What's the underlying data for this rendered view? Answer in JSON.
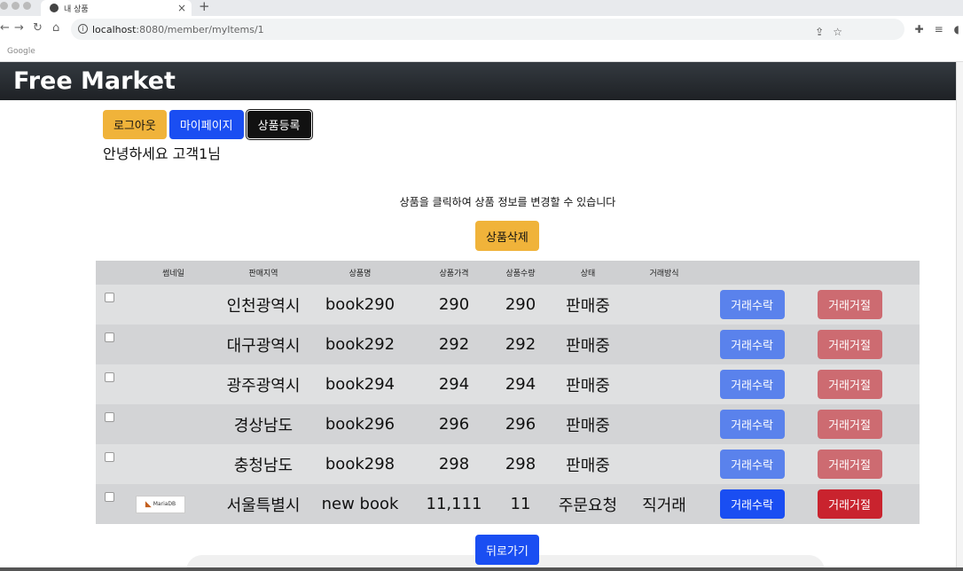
{
  "browser": {
    "tab_title": "내 상품",
    "url_host": "localhost",
    "url_path": ":8080/member/myItems/1",
    "bookmark": "Google"
  },
  "site": {
    "brand": "Free Market",
    "logout": "로그아웃",
    "mypage": "마이페이지",
    "register": "상품등록",
    "greeting": "안녕하세요 고객1님",
    "hint": "상품을 클릭하여 상품 정보를 변경할 수 있습니다",
    "delete": "상품삭제",
    "back": "뒤로가기"
  },
  "table": {
    "headers": [
      "썸네일",
      "판매지역",
      "상품명",
      "상품가격",
      "상품수량",
      "상태",
      "거래방식"
    ],
    "accept_label": "거래수락",
    "reject_label": "거래거절",
    "rows": [
      {
        "thumb": "",
        "region": "인천광역시",
        "name": "book290",
        "price": "290",
        "qty": "290",
        "status": "판매중",
        "method": ""
      },
      {
        "thumb": "",
        "region": "대구광역시",
        "name": "book292",
        "price": "292",
        "qty": "292",
        "status": "판매중",
        "method": ""
      },
      {
        "thumb": "",
        "region": "광주광역시",
        "name": "book294",
        "price": "294",
        "qty": "294",
        "status": "판매중",
        "method": ""
      },
      {
        "thumb": "",
        "region": "경상남도",
        "name": "book296",
        "price": "296",
        "qty": "296",
        "status": "판매중",
        "method": ""
      },
      {
        "thumb": "",
        "region": "충청남도",
        "name": "book298",
        "price": "298",
        "qty": "298",
        "status": "판매중",
        "method": ""
      },
      {
        "thumb": "MariaDB",
        "region": "서울특별시",
        "name": "new book",
        "price": "11,111",
        "qty": "11",
        "status": "주문요청",
        "method": "직거래"
      }
    ]
  }
}
